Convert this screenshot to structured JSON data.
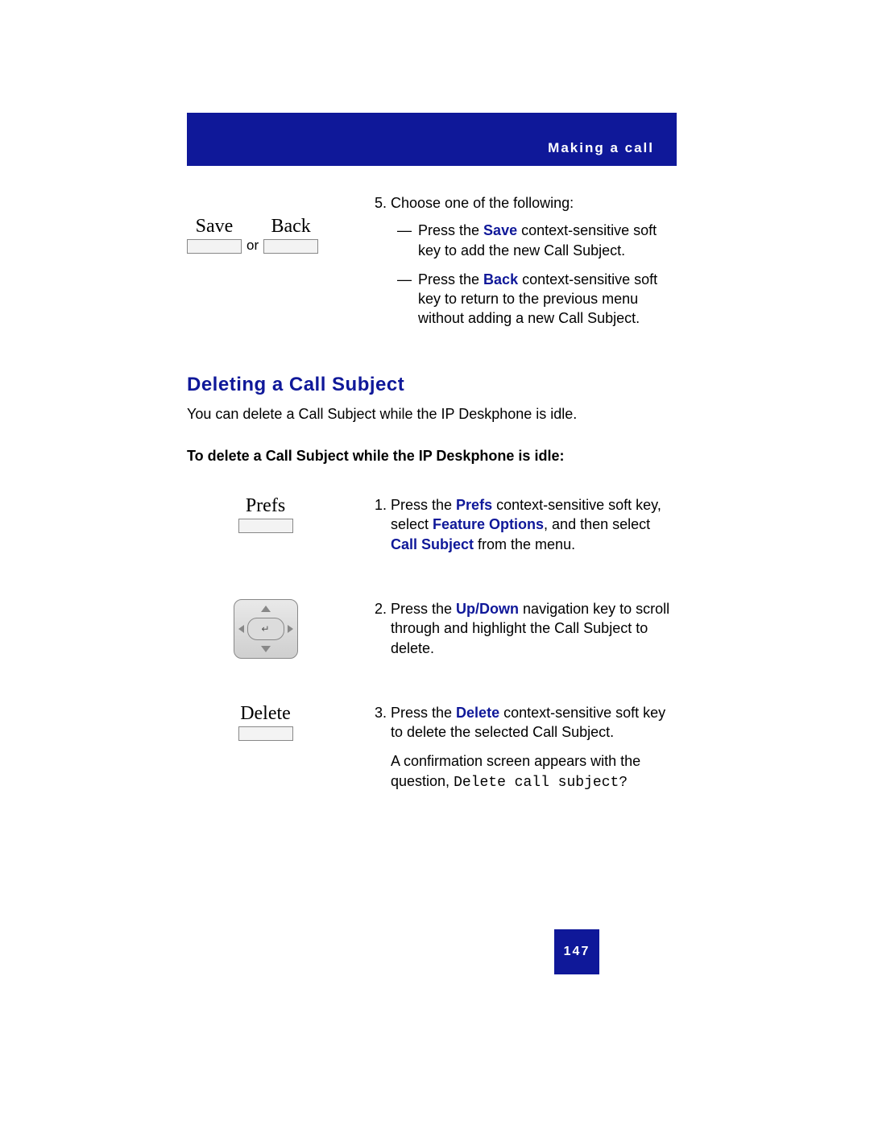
{
  "header": {
    "title": "Making a call"
  },
  "step5": {
    "number": "5.",
    "intro": "Choose one of the following:",
    "save_label": "Save",
    "back_label": "Back",
    "or_text": "or",
    "bullet1_pre": "Press the ",
    "bullet1_bold": "Save",
    "bullet1_post": " context-sensitive soft key to add the new Call Subject.",
    "bullet2_pre": "Press the ",
    "bullet2_bold": "Back",
    "bullet2_post": " context-sensitive soft key to return to the previous menu without adding a new Call Subject."
  },
  "section": {
    "heading": "Deleting a Call Subject",
    "intro": "You can delete a Call Subject while the IP Deskphone is idle.",
    "sub_heading": "To delete a Call Subject while the IP Deskphone is idle:"
  },
  "del_step1": {
    "softkey_label": "Prefs",
    "number": "1.",
    "t1": "Press the ",
    "b1": "Prefs",
    "t2": " context-sensitive soft key, select ",
    "b2": "Feature Options",
    "t3": ", and then select ",
    "b3": "Call Subject",
    "t4": " from the menu."
  },
  "del_step2": {
    "number": "2.",
    "t1": "Press the ",
    "b1": "Up/Down",
    "t2": " navigation key to scroll through and highlight the Call Subject to delete."
  },
  "del_step3": {
    "softkey_label": "Delete",
    "number": "3.",
    "t1": "Press the ",
    "b1": "Delete",
    "t2": " context-sensitive soft key to delete the selected Call Subject.",
    "confirm_pre": "A confirmation screen appears with the question, ",
    "confirm_mono": "Delete call subject?"
  },
  "page_number": "147"
}
